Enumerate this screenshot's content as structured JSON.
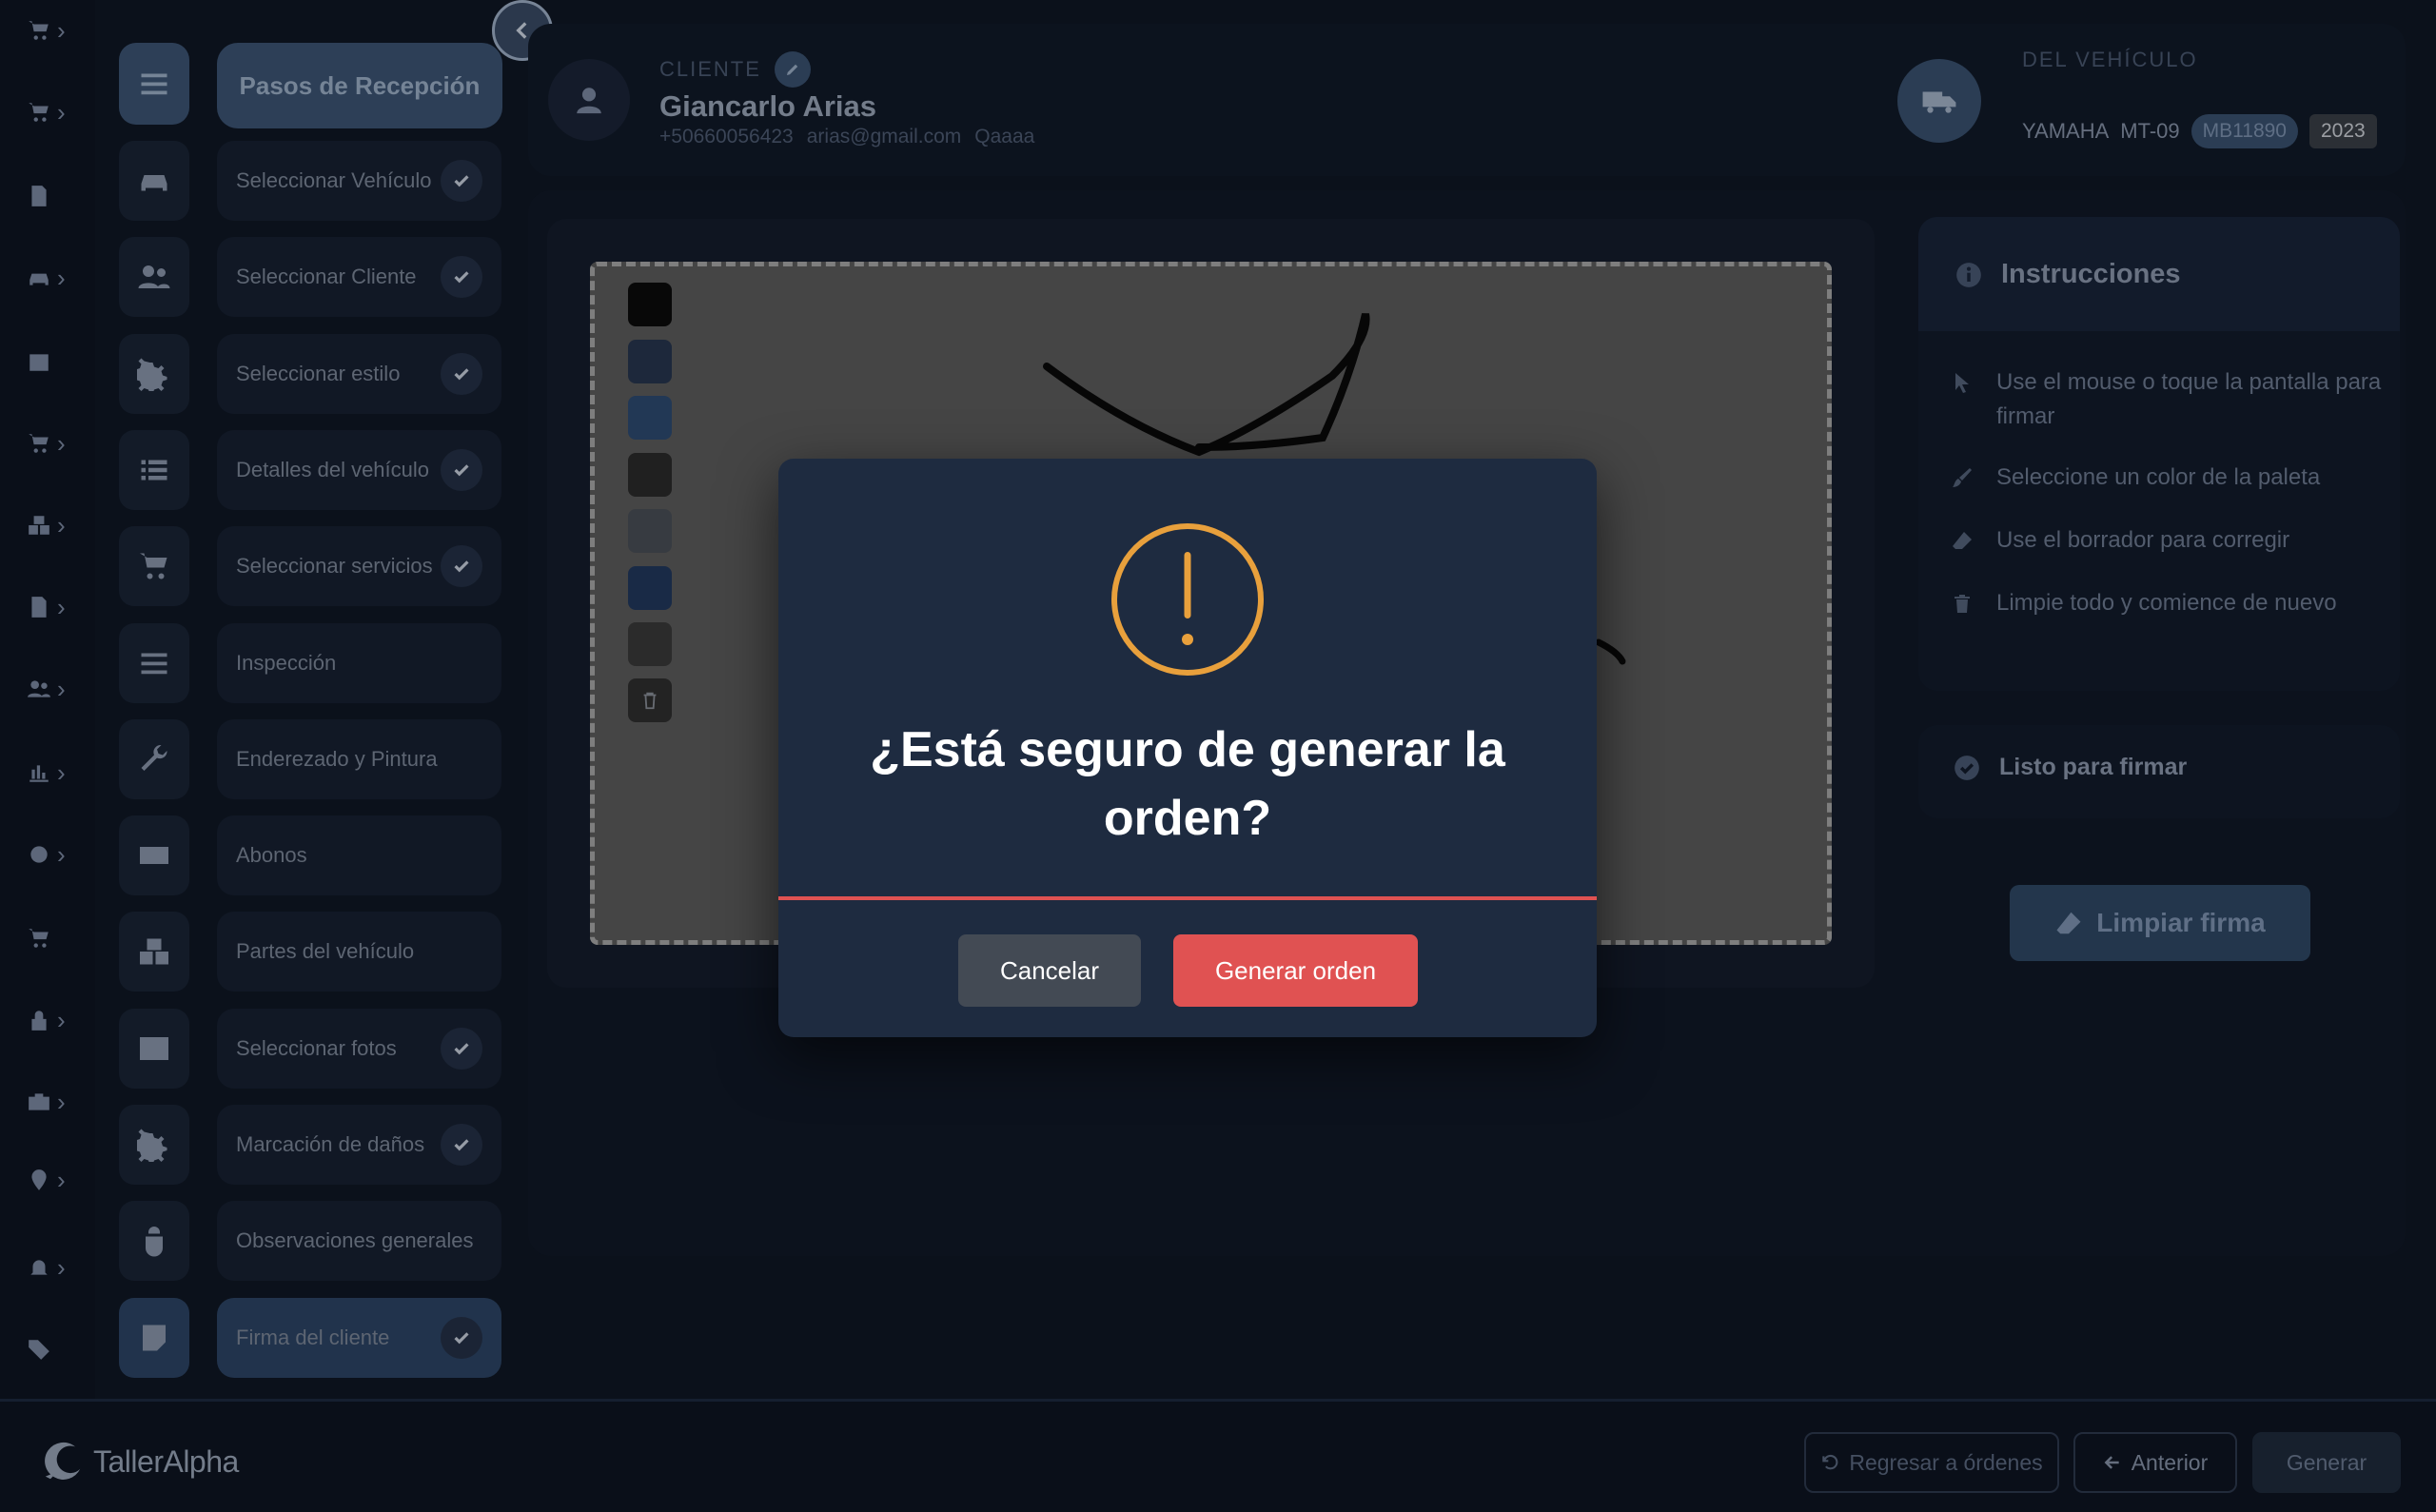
{
  "header": {
    "client_label": "CLIENTE",
    "client_name": "Giancarlo Arias",
    "client_phone": "+50660056423",
    "client_email": "arias@gmail.com",
    "client_extra": "Qaaaa",
    "vehicle_label": "DEL VEHÍCULO",
    "vehicle_brand": "YAMAHA",
    "vehicle_model": "MT-09",
    "vehicle_plate": "MB11890",
    "vehicle_year": "2023"
  },
  "steps": {
    "title": "Pasos de Recepción",
    "items": [
      {
        "label": "Seleccionar Vehículo",
        "done": true,
        "icon": "car-icon"
      },
      {
        "label": "Seleccionar Cliente",
        "done": true,
        "icon": "users-icon"
      },
      {
        "label": "Seleccionar estilo",
        "done": true,
        "icon": "gears-icon"
      },
      {
        "label": "Detalles del vehículo",
        "done": true,
        "icon": "list-icon"
      },
      {
        "label": "Seleccionar servicios",
        "done": true,
        "icon": "cart-icon"
      },
      {
        "label": "Inspección",
        "done": false,
        "icon": "bars-icon"
      },
      {
        "label": "Enderezado y Pintura",
        "done": false,
        "icon": "wrench-icon"
      },
      {
        "label": "Abonos",
        "done": false,
        "icon": "money-icon"
      },
      {
        "label": "Partes del vehículo",
        "done": false,
        "icon": "boxes-icon"
      },
      {
        "label": "Seleccionar fotos",
        "done": true,
        "icon": "image-icon"
      },
      {
        "label": "Marcación de daños",
        "done": true,
        "icon": "gears-icon"
      },
      {
        "label": "Observaciones generales",
        "done": false,
        "icon": "bug-icon"
      },
      {
        "label": "Firma del cliente",
        "done": true,
        "icon": "note-icon",
        "active": true
      }
    ]
  },
  "instructions": {
    "title": "Instrucciones",
    "items": [
      {
        "text": "Use el mouse o toque la pantalla para firmar",
        "icon": "pointer-icon"
      },
      {
        "text": "Seleccione un color de la paleta",
        "icon": "brush-icon"
      },
      {
        "text": "Use el borrador para corregir",
        "icon": "eraser-icon"
      },
      {
        "text": "Limpie todo y comience de nuevo",
        "icon": "trash-icon"
      }
    ],
    "ready": "Listo para firmar",
    "clear_button": "Limpiar firma"
  },
  "palette_colors": [
    "#0b0b0b",
    "#27364f",
    "#2e4b72",
    "#2b2b2b",
    "#4a4f57",
    "#22395e",
    "#3a3a3a"
  ],
  "bottom": {
    "logo": "TallerAlpha",
    "back_orders": "Regresar a órdenes",
    "previous": "Anterior",
    "generate": "Generar"
  },
  "modal": {
    "title": "¿Está seguro de generar la orden?",
    "cancel": "Cancelar",
    "confirm": "Generar orden",
    "warning_color": "#e8a03c",
    "confirm_color": "#e05252"
  }
}
